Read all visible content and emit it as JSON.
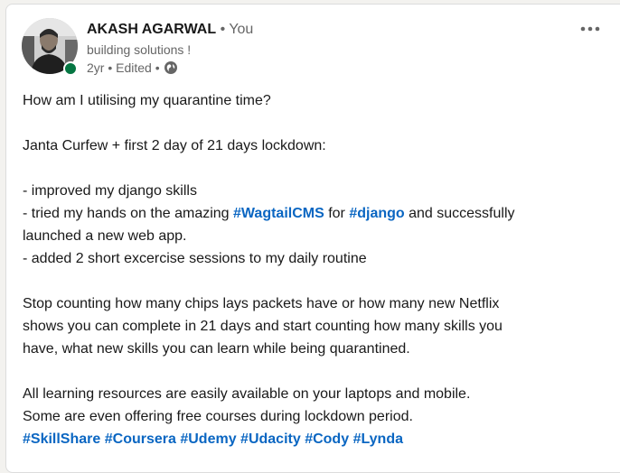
{
  "author": {
    "name": "AKASH AGARWAL",
    "degree": "• You",
    "headline": "building solutions !",
    "time": "2yr • Edited •"
  },
  "post": {
    "line1": "How am I utilising my quarantine time?",
    "line2": "Janta Curfew + first 2 day of 21 days lockdown:",
    "bullet1": "- improved my django skills",
    "bullet2_pre": "- tried my hands on the amazing ",
    "bullet2_tag1": "#WagtailCMS",
    "bullet2_mid": " for ",
    "bullet2_tag2": "#django",
    "bullet2_post": " and successfully",
    "bullet2_cont": "launched a new web app.",
    "bullet3": "- added 2 short excercise sessions to my daily routine",
    "para2_l1": "Stop counting how many chips lays packets have or how many new Netflix",
    "para2_l2": "shows you can complete in 21 days and start counting how many skills you",
    "para2_l3": "have, what new skills you can learn while being quarantined.",
    "para3_l1": "All learning resources are easily available on your laptops and mobile.",
    "para3_l2": "Some are even offering free courses during lockdown period.",
    "hashtags": [
      "#SkillShare",
      "#Coursera",
      "#Udemy",
      "#Udacity",
      "#Cody",
      "#Lynda"
    ]
  },
  "colors": {
    "link": "#0a66c2",
    "presence": "#057642"
  },
  "icons": {
    "menu": "more-horizontal-icon",
    "visibility": "globe-icon"
  }
}
